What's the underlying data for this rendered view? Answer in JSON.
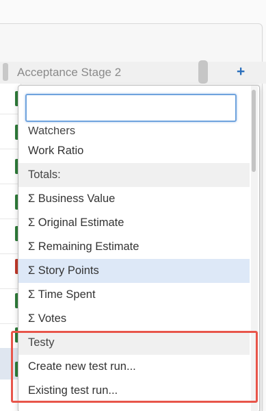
{
  "column": {
    "title": "Acceptance Stage 2",
    "add_glyph": "+"
  },
  "dropdown": {
    "search_value": "",
    "items": [
      {
        "label": "Watchers",
        "kind": "partial"
      },
      {
        "label": "Work Ratio",
        "kind": "option"
      },
      {
        "label": "Totals:",
        "kind": "group"
      },
      {
        "label": "Σ Business Value",
        "kind": "option"
      },
      {
        "label": "Σ Original Estimate",
        "kind": "option"
      },
      {
        "label": "Σ Remaining Estimate",
        "kind": "option"
      },
      {
        "label": "Σ Story Points",
        "kind": "selected"
      },
      {
        "label": "Σ Time Spent",
        "kind": "option"
      },
      {
        "label": "Σ Votes",
        "kind": "option"
      },
      {
        "label": "Testy",
        "kind": "group"
      },
      {
        "label": "Create new test run...",
        "kind": "option"
      },
      {
        "label": "Existing test run...",
        "kind": "option"
      }
    ]
  },
  "colors": {
    "highlight": "#e8554a",
    "selected_row": "#dde8f7",
    "accent": "#2a6ebb",
    "card_green": "#2f7d3a",
    "card_red": "#c0392b"
  }
}
